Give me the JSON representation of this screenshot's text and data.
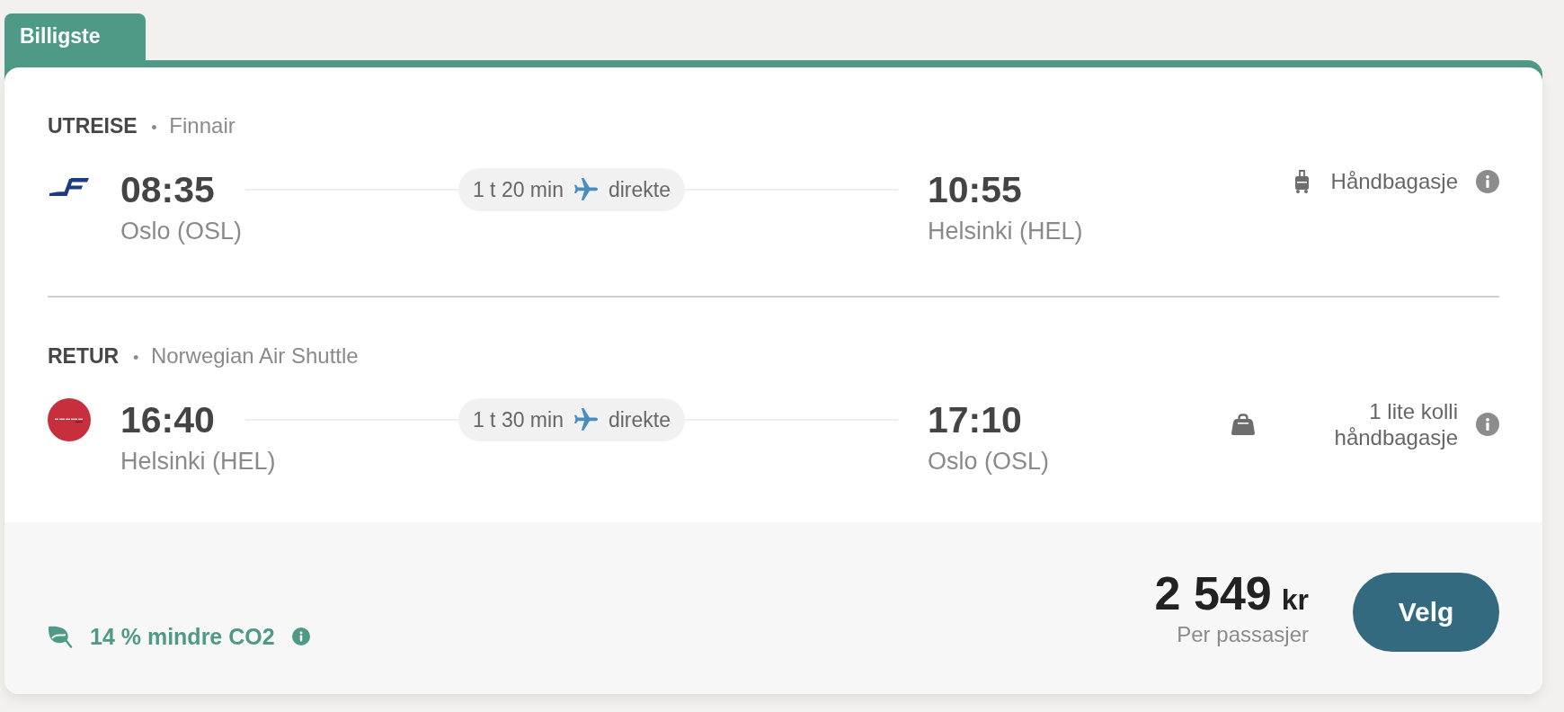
{
  "badge": {
    "text": "Billigste"
  },
  "legs": [
    {
      "direction": "UTREISE",
      "separator": "•",
      "airline": "Finnair",
      "departure": {
        "time": "08:35",
        "airport": "Oslo (OSL)"
      },
      "duration": "1 t 20 min",
      "stops": "direkte",
      "arrival": {
        "time": "10:55",
        "airport": "Helsinki (HEL)"
      },
      "baggage": {
        "kind": "carry_on",
        "text": "Håndbagasje"
      }
    },
    {
      "direction": "RETUR",
      "separator": "•",
      "airline": "Norwegian Air Shuttle",
      "departure": {
        "time": "16:40",
        "airport": "Helsinki (HEL)"
      },
      "duration": "1 t 30 min",
      "stops": "direkte",
      "arrival": {
        "time": "17:10",
        "airport": "Oslo (OSL)"
      },
      "baggage": {
        "kind": "small_item",
        "text": "1 lite kolli håndbagasje"
      }
    }
  ],
  "footer": {
    "co2": "14 % mindre CO2",
    "price": "2 549",
    "currency": "kr",
    "note": "Per passasjer",
    "button": "Velg"
  }
}
